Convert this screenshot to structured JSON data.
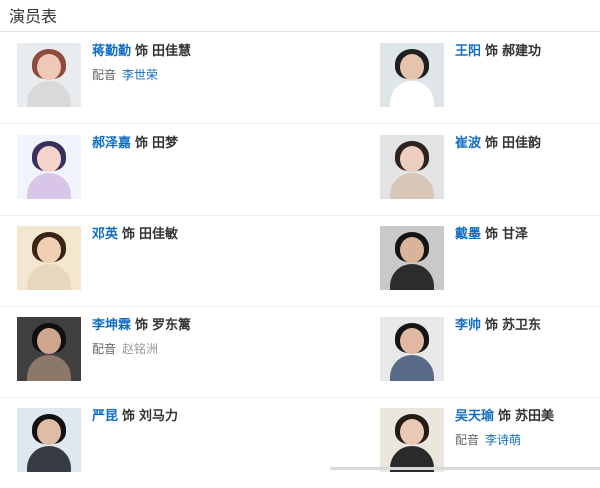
{
  "section_title": "演员表",
  "role_separator": "饰",
  "dub_label": "配音",
  "cast": [
    {
      "actor": "蒋勤勤",
      "role": "田佳慧",
      "dubber": "李世荣",
      "avatar_theme": {
        "bg": "#e9ecef",
        "hair": "#8f4a3c",
        "skin": "#f0c8b8",
        "cloth": "#d9d9d9"
      }
    },
    {
      "actor": "王阳",
      "role": "郝建功",
      "avatar_theme": {
        "bg": "#dfe6ea",
        "hair": "#1f1f1f",
        "skin": "#e6c4ac",
        "cloth": "#ffffff"
      }
    },
    {
      "actor": "郝泽嘉",
      "role": "田梦",
      "avatar_theme": {
        "bg": "#f1f4fb",
        "hair": "#3b2f5e",
        "skin": "#f4d4cb",
        "cloth": "#d9c5e8"
      }
    },
    {
      "actor": "崔波",
      "role": "田佳韵",
      "avatar_theme": {
        "bg": "#e3e3e3",
        "hair": "#2d2420",
        "skin": "#edcdbd",
        "cloth": "#d8c6b6"
      }
    },
    {
      "actor": "邓英",
      "role": "田佳敏",
      "avatar_theme": {
        "bg": "#f3e7cf",
        "hair": "#3a2415",
        "skin": "#f0cfb2",
        "cloth": "#e9d6bf"
      }
    },
    {
      "actor": "戴墨",
      "role": "甘泽",
      "avatar_theme": {
        "bg": "#c9c9c9",
        "hair": "#151515",
        "skin": "#d9b49b",
        "cloth": "#2c2c2c"
      }
    },
    {
      "actor": "李坤霖",
      "role": "罗东篱",
      "dubber": "赵铭洲",
      "dubber_plain": true,
      "avatar_theme": {
        "bg": "#3f3f3f",
        "hair": "#101010",
        "skin": "#cfa58c",
        "cloth": "#8b7868"
      }
    },
    {
      "actor": "李帅",
      "role": "苏卫东",
      "avatar_theme": {
        "bg": "#e8e8e8",
        "hair": "#151515",
        "skin": "#e1b9a2",
        "cloth": "#596b86"
      }
    },
    {
      "actor": "严昆",
      "role": "刘马力",
      "avatar_theme": {
        "bg": "#dfe8f1",
        "hair": "#111111",
        "skin": "#e1bca4",
        "cloth": "#363b45"
      }
    },
    {
      "actor": "吴天瑜",
      "role": "苏田美",
      "dubber": "李诗萌",
      "avatar_theme": {
        "bg": "#ebe7df",
        "hair": "#261c16",
        "skin": "#e9c9b4",
        "cloth": "#2a2a2a"
      }
    }
  ]
}
